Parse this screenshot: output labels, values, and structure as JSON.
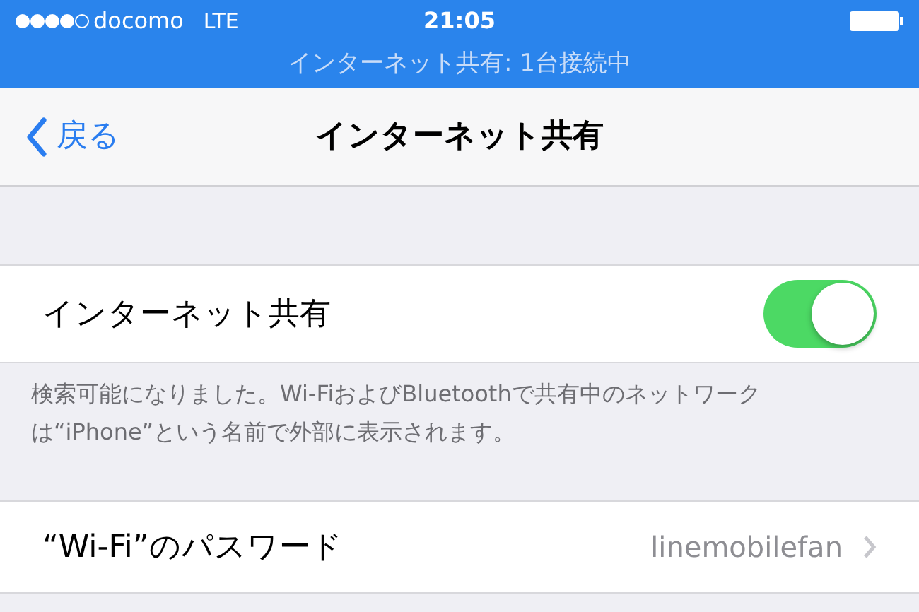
{
  "status_bar": {
    "carrier": "docomo",
    "network": "LTE",
    "time": "21:05"
  },
  "tethering_banner": "インターネット共有: 1台接続中",
  "nav": {
    "back": "戻る",
    "title": "インターネット共有"
  },
  "hotspot": {
    "label": "インターネット共有",
    "on": true
  },
  "footer": "検索可能になりました。Wi-FiおよびBluetoothで共有中のネットワークは“iPhone”という名前で外部に表示されます。",
  "password": {
    "label": "“Wi-Fi”のパスワード",
    "value": "linemobilefan"
  }
}
